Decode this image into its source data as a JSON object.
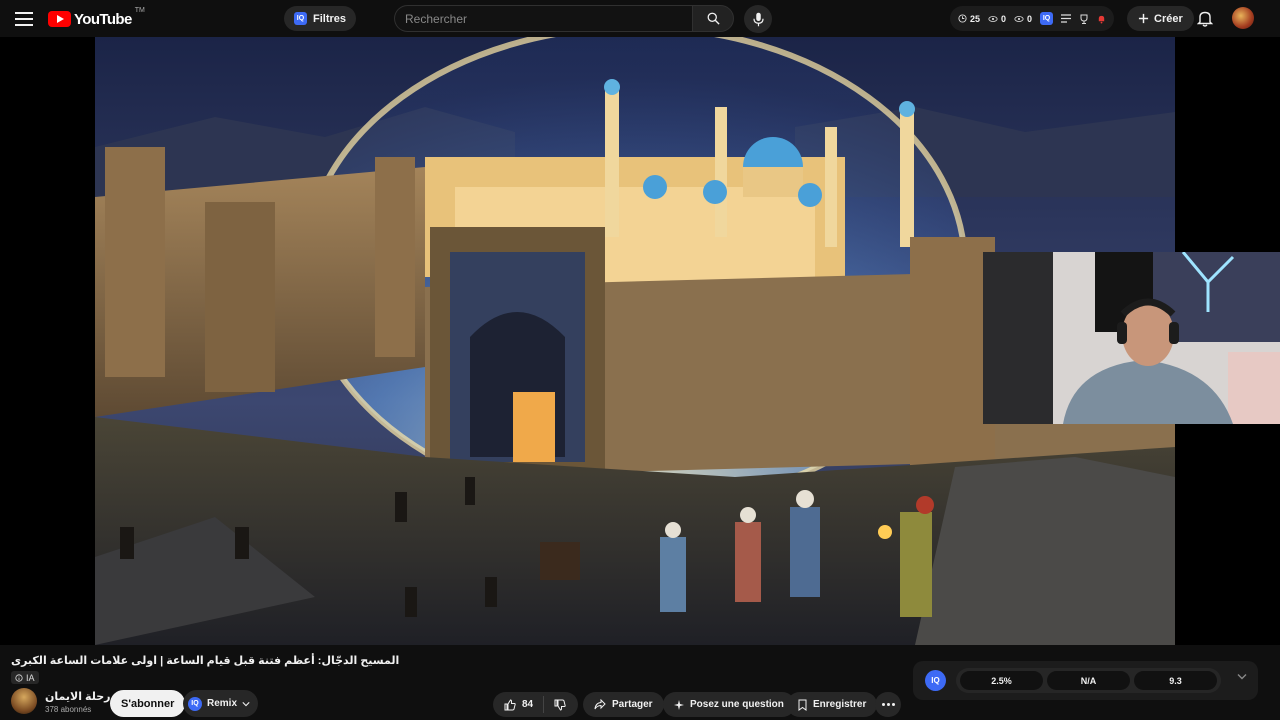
{
  "header": {
    "logo_text": "YouTube",
    "logo_tm": "TM",
    "filters_label": "Filtres",
    "search_placeholder": "Rechercher",
    "stats": {
      "count1": "25",
      "count2": "0",
      "count3": "0"
    },
    "create_label": "Créer"
  },
  "video": {
    "title": "المسيح الدجّال: أعظم فتنة قبل قيام الساعة | اولى علامات الساعة الكبرى",
    "ai_badge": "IA"
  },
  "channel": {
    "name": "رحلة الايمان",
    "subscribers": "378 abonnés",
    "subscribe_label": "S'abonner",
    "remix_label": "Remix"
  },
  "actions": {
    "like_count": "84",
    "share_label": "Partager",
    "ask_label": "Posez une question",
    "save_label": "Enregistrer"
  },
  "iq_panel": {
    "badge": "IQ",
    "metric1": "2.5%",
    "metric2": "N/A",
    "metric3": "9.3"
  },
  "icons": [
    "menu-icon",
    "search-icon",
    "mic-icon",
    "clock-icon",
    "eye-icon",
    "list-icon",
    "bell-icon",
    "plus-icon",
    "like-icon",
    "dislike-icon",
    "share-icon",
    "sparkle-icon",
    "bookmark-icon",
    "more-icon",
    "chevron-down-icon",
    "info-icon"
  ],
  "colors": {
    "background": "#0f0f0f",
    "brand": "#ff0000",
    "iq_accent": "#3d6af5"
  }
}
